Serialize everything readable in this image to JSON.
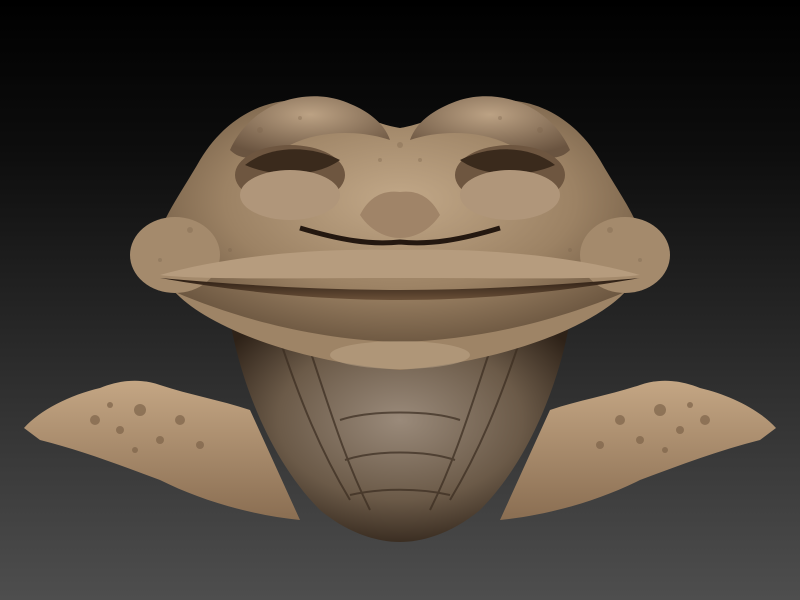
{
  "viewport": {
    "background_top": "#000000",
    "background_bottom": "#4e4e4e"
  },
  "model": {
    "subject": "sculpted-frog-head",
    "material_color": "#a88c6c",
    "shadow_color": "#3a2c1e",
    "highlight_color": "#d0b898"
  }
}
